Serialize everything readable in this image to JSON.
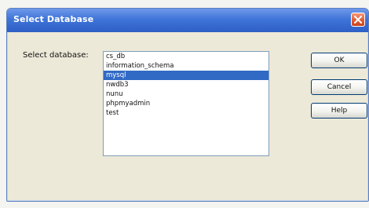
{
  "window": {
    "title": "Select Database"
  },
  "form": {
    "label": "Select database:",
    "selected_database": "mysql"
  },
  "databases": [
    {
      "name": "cs_db",
      "selected": false
    },
    {
      "name": "information_schema",
      "selected": false
    },
    {
      "name": "mysql",
      "selected": true
    },
    {
      "name": "nwdb3",
      "selected": false
    },
    {
      "name": "nunu",
      "selected": false
    },
    {
      "name": "phpmyadmin",
      "selected": false
    },
    {
      "name": "test",
      "selected": false
    }
  ],
  "buttons": {
    "ok": "OK",
    "cancel": "Cancel",
    "help": "Help"
  },
  "icons": {
    "close": "close-icon"
  },
  "colors": {
    "title_bar": "#3f74d8",
    "selection": "#316ac5",
    "close_button": "#e25b35"
  }
}
